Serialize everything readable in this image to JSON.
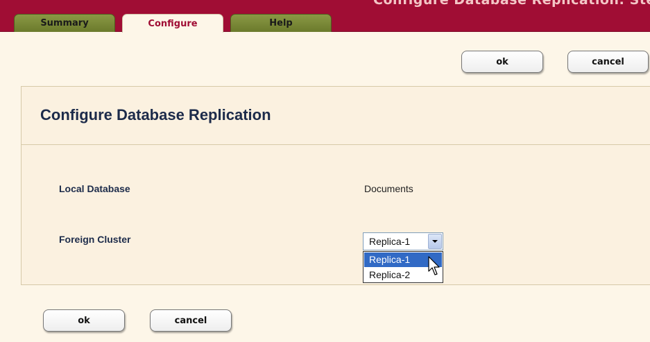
{
  "header": {
    "title": "Configure Database Replication: Step"
  },
  "tabs": [
    {
      "label": "Summary",
      "active": false
    },
    {
      "label": "Configure",
      "active": true
    },
    {
      "label": "Help",
      "active": false
    }
  ],
  "top_actions": {
    "ok_label": "ok",
    "cancel_label": "cancel"
  },
  "panel": {
    "title": "Configure Database Replication",
    "local_database_label": "Local Database",
    "local_database_value": "Documents",
    "foreign_cluster_label": "Foreign Cluster",
    "foreign_cluster_selected": "Replica-1",
    "foreign_cluster_options": [
      "Replica-1",
      "Replica-2"
    ]
  },
  "bottom_actions": {
    "ok_label": "ok",
    "cancel_label": "cancel"
  },
  "colors": {
    "header_red": "#a00d34",
    "tab_olive": "#7c8a3a",
    "page_background": "#fdf6e8",
    "title_navy": "#1c2b4a",
    "selection_blue": "#316ac5"
  },
  "icons": {
    "dropdown_arrow": "chevron-down-icon",
    "cursor": "pointer-cursor-icon"
  }
}
